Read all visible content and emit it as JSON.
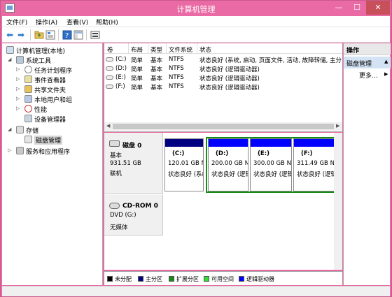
{
  "window": {
    "title": "计算机管理",
    "min_glyph": "—",
    "max_glyph": "☐",
    "close_glyph": "✕"
  },
  "menubar": {
    "items": [
      {
        "label": "文件(F)"
      },
      {
        "label": "操作(A)"
      },
      {
        "label": "查看(V)"
      },
      {
        "label": "帮助(H)"
      }
    ]
  },
  "toolbar": {
    "back_glyph": "⬅",
    "forward_glyph": "➡"
  },
  "tree": {
    "root": "计算机管理(本地)",
    "system_tools": "系统工具",
    "task_scheduler": "任务计划程序",
    "event_viewer": "事件查看器",
    "shared_folders": "共享文件夹",
    "local_users": "本地用户和组",
    "performance": "性能",
    "device_manager": "设备管理器",
    "storage": "存储",
    "disk_management": "磁盘管理",
    "services_apps": "服务和应用程序",
    "collapsed_glyph": "▷",
    "expanded_glyph": "◢"
  },
  "volume_list": {
    "columns": [
      "卷",
      "布局",
      "类型",
      "文件系统",
      "状态"
    ],
    "rows": [
      {
        "volume": "(C:)",
        "layout": "简单",
        "type": "基本",
        "fs": "NTFS",
        "status": "状态良好 (系统, 启动, 页面文件, 活动, 故障转储, 主分"
      },
      {
        "volume": "(D:)",
        "layout": "简单",
        "type": "基本",
        "fs": "NTFS",
        "status": "状态良好 (逻辑驱动器)"
      },
      {
        "volume": "(E:)",
        "layout": "简单",
        "type": "基本",
        "fs": "NTFS",
        "status": "状态良好 (逻辑驱动器)"
      },
      {
        "volume": "(F:)",
        "layout": "简单",
        "type": "基本",
        "fs": "NTFS",
        "status": "状态良好 (逻辑驱动器)"
      }
    ]
  },
  "disks": {
    "disk0": {
      "title": "磁盘 0",
      "type": "基本",
      "size": "931.51 GB",
      "state": "联机",
      "partitions": [
        {
          "name": "(C:)",
          "size": "120.01 GB NTFS",
          "status": "状态良好 (系统",
          "color": "#000080"
        },
        {
          "name": "(D:)",
          "size": "200.00 GB NTFS",
          "status": "状态良好 (逻辑驱动器)",
          "color": "#0000ff"
        },
        {
          "name": "(E:)",
          "size": "300.00 GB NTFS",
          "status": "状态良好 (逻辑驱动器)",
          "color": "#0000ff"
        },
        {
          "name": "(F:)",
          "size": "311.49 GB NTFS",
          "status": "状态良好 (逻辑驱动器)",
          "color": "#0000ff"
        }
      ]
    },
    "cdrom0": {
      "title": "CD-ROM 0",
      "type": "DVD (G:)",
      "media": "无媒体"
    }
  },
  "legend": [
    {
      "label": "未分配",
      "color": "#000000"
    },
    {
      "label": "主分区",
      "color": "#000080"
    },
    {
      "label": "扩展分区",
      "color": "#178a17"
    },
    {
      "label": "可用空间",
      "color": "#33dd33"
    },
    {
      "label": "逻辑驱动器",
      "color": "#0000ff"
    }
  ],
  "actions": {
    "header": "操作",
    "section": "磁盘管理",
    "more": "更多...",
    "arrow_glyph": "▲",
    "more_arrow_glyph": "▶"
  }
}
